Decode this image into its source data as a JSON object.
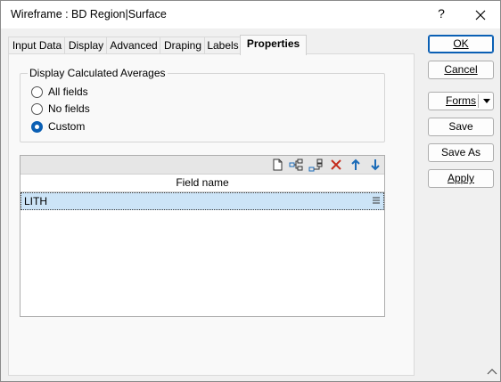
{
  "window": {
    "title": "Wireframe : BD Region|Surface",
    "help": "?",
    "close_icon": "close-icon"
  },
  "tabs": [
    {
      "label": "Input Data",
      "active": false
    },
    {
      "label": "Display",
      "active": false
    },
    {
      "label": "Advanced",
      "active": false
    },
    {
      "label": "Draping",
      "active": false
    },
    {
      "label": "Labels",
      "active": false
    },
    {
      "label": "Properties",
      "active": true
    }
  ],
  "averages": {
    "group_title": "Display Calculated Averages",
    "options": [
      {
        "label": "All fields",
        "checked": false
      },
      {
        "label": "No fields",
        "checked": false
      },
      {
        "label": "Custom",
        "checked": true
      }
    ]
  },
  "grid": {
    "toolbar_icons": [
      "new-document-icon",
      "insert-row-icon",
      "append-row-icon",
      "delete-icon",
      "move-up-icon",
      "move-down-icon"
    ],
    "column_header": "Field name",
    "rows": [
      {
        "field_name": "LITH"
      }
    ]
  },
  "buttons": {
    "ok": "OK",
    "cancel": "Cancel",
    "forms": "Forms",
    "save": "Save",
    "save_as": "Save As",
    "apply": "Apply"
  },
  "colors": {
    "accent": "#0a5fb4",
    "selection": "#cce4f7",
    "delete": "#c42b1c",
    "arrow": "#1a6bb8"
  }
}
